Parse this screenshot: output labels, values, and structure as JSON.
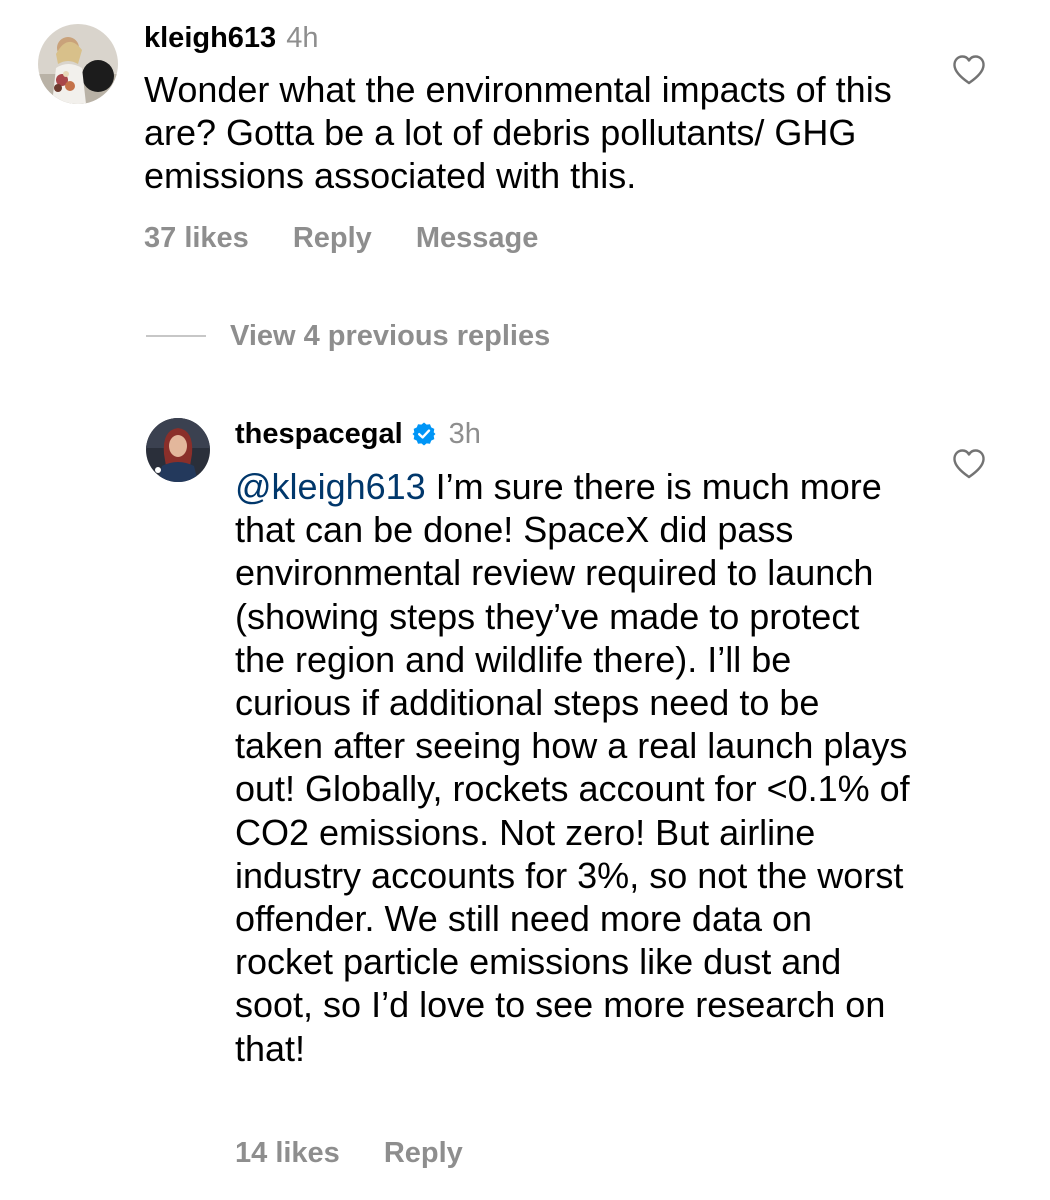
{
  "comments": [
    {
      "username": "kleigh613",
      "time": "4h",
      "avatar_icon": "profile-photo",
      "text": "Wonder what the environmental impacts of this are? Gotta be a lot of debris pollutants/ GHG emissions associated with this.",
      "likes": "37 likes",
      "reply_label": "Reply",
      "message_label": "Message",
      "like_icon": "heart-outline-icon"
    },
    {
      "username": "thespacegal",
      "verified": true,
      "verified_color": "#0095f6",
      "time": "3h",
      "avatar_icon": "profile-photo",
      "mention": "@kleigh613",
      "mention_color": "#00376b",
      "text": " I’m sure there is much more that can be done! SpaceX did pass environmental review required to launch (showing steps they’ve made to protect the region and wildlife there). I’ll be curious if additional steps need to be taken after seeing how a real launch plays out! Globally, rockets account for <0.1% of CO2 emissions. Not zero! But airline industry accounts for  3%, so not the worst offender. We still need more data on rocket particle emissions like dust and soot, so I’d love to see more research on that!",
      "likes": "14 likes",
      "reply_label": "Reply",
      "like_icon": "heart-outline-icon"
    }
  ],
  "view_previous_replies": "View 4 previous replies",
  "colors": {
    "secondary_text": "#8e8e8e",
    "primary_text": "#000000",
    "divider": "#c7c7c7"
  }
}
